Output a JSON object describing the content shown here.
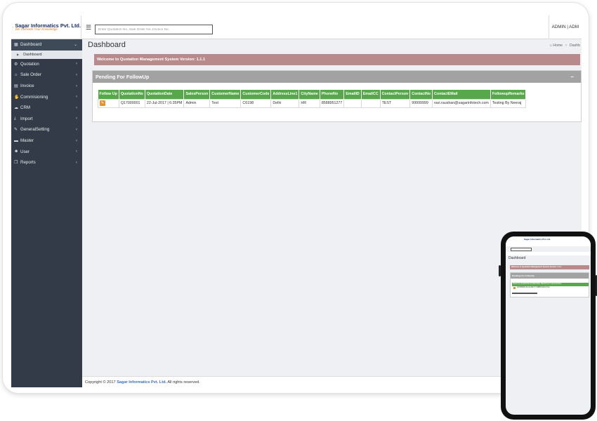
{
  "header": {
    "logo_name": "Sagar Informatics Pvt. Ltd.",
    "logo_tagline": "We Cultivate Your Knowledge",
    "search_placeholder": "Enter Quotation No.,Sale Order No.,Invoice No.",
    "user_label": "ADMIN | ADM"
  },
  "sidebar": {
    "items": [
      {
        "label": "Dashboard",
        "icon": "dashboard-icon",
        "glyph": "▦",
        "expanded": true
      },
      {
        "label": "Quotation",
        "icon": "gear-icon",
        "glyph": "⚙"
      },
      {
        "label": "Sale Order",
        "icon": "cog-icon",
        "glyph": "☼"
      },
      {
        "label": "Invoice",
        "icon": "invoice-icon",
        "glyph": "▤"
      },
      {
        "label": "Commisioning",
        "icon": "thumbs-up-icon",
        "glyph": "✋"
      },
      {
        "label": "CRM",
        "icon": "chat-icon",
        "glyph": "☁"
      },
      {
        "label": "Import",
        "icon": "download-icon",
        "glyph": "⤓"
      },
      {
        "label": "GeneralSetting",
        "icon": "wrench-icon",
        "glyph": "✎"
      },
      {
        "label": "Master",
        "icon": "briefcase-icon",
        "glyph": "▬"
      },
      {
        "label": "User",
        "icon": "user-icon",
        "glyph": "☻"
      },
      {
        "label": "Reports",
        "icon": "copy-icon",
        "glyph": "❐"
      }
    ],
    "sub_item": "Dashboard"
  },
  "page": {
    "title": "Dashboard",
    "breadcrumb_home": "Home",
    "breadcrumb_current": "Dashb",
    "welcome": "Welcome to Quotation Management System Version: 1.1.1"
  },
  "panel": {
    "title": "Pending For FollowUp",
    "collapse_glyph": "–"
  },
  "table": {
    "columns": [
      "Follow Up",
      "QuotationNo",
      "QuotationDate",
      "SalesPerson",
      "CustomerName",
      "CustomerCode",
      "AddressLine1",
      "CityName",
      "PhoneNo",
      "EmailID",
      "EmailCC",
      "ContactPerson",
      "ContactNo",
      "ContactEMail",
      "FollowupRemarks"
    ],
    "rows": [
      [
        "",
        "Q17000001",
        "22-Jul-2017 | 6:35PM",
        "Admin",
        "Test",
        "C6198",
        "Delhi",
        "HR",
        "8588951277",
        "",
        "",
        "TEST",
        "99999999",
        "ravi.raushan@sagarinfotech.com",
        "Testing By Neeraj"
      ]
    ]
  },
  "footer": {
    "prefix": "Copyright © 2017",
    "brand": "Sagar Informatics Pvt. Ltd.",
    "suffix": "All rights reserved."
  },
  "phone": {
    "logo_name": "Sagar Informatics Pvt. Ltd.",
    "title": "Dashboard",
    "welcome": "Welcome to Quotation Management System Version: 1.1.1",
    "panel_title": "Pending For FollowUp",
    "thead": "Follow Up QuotationNo QuotationDate SalesPerson CustomerName",
    "row": "Q17000001 22-Jul-2017 | 6:35PM Admin Test"
  },
  "colors": {
    "sidebar": "#323b47",
    "welcome_bar": "#b98a8c",
    "table_header": "#57a84a",
    "panel_header": "#a2a2a2",
    "brand_link": "#3c6ec8"
  }
}
